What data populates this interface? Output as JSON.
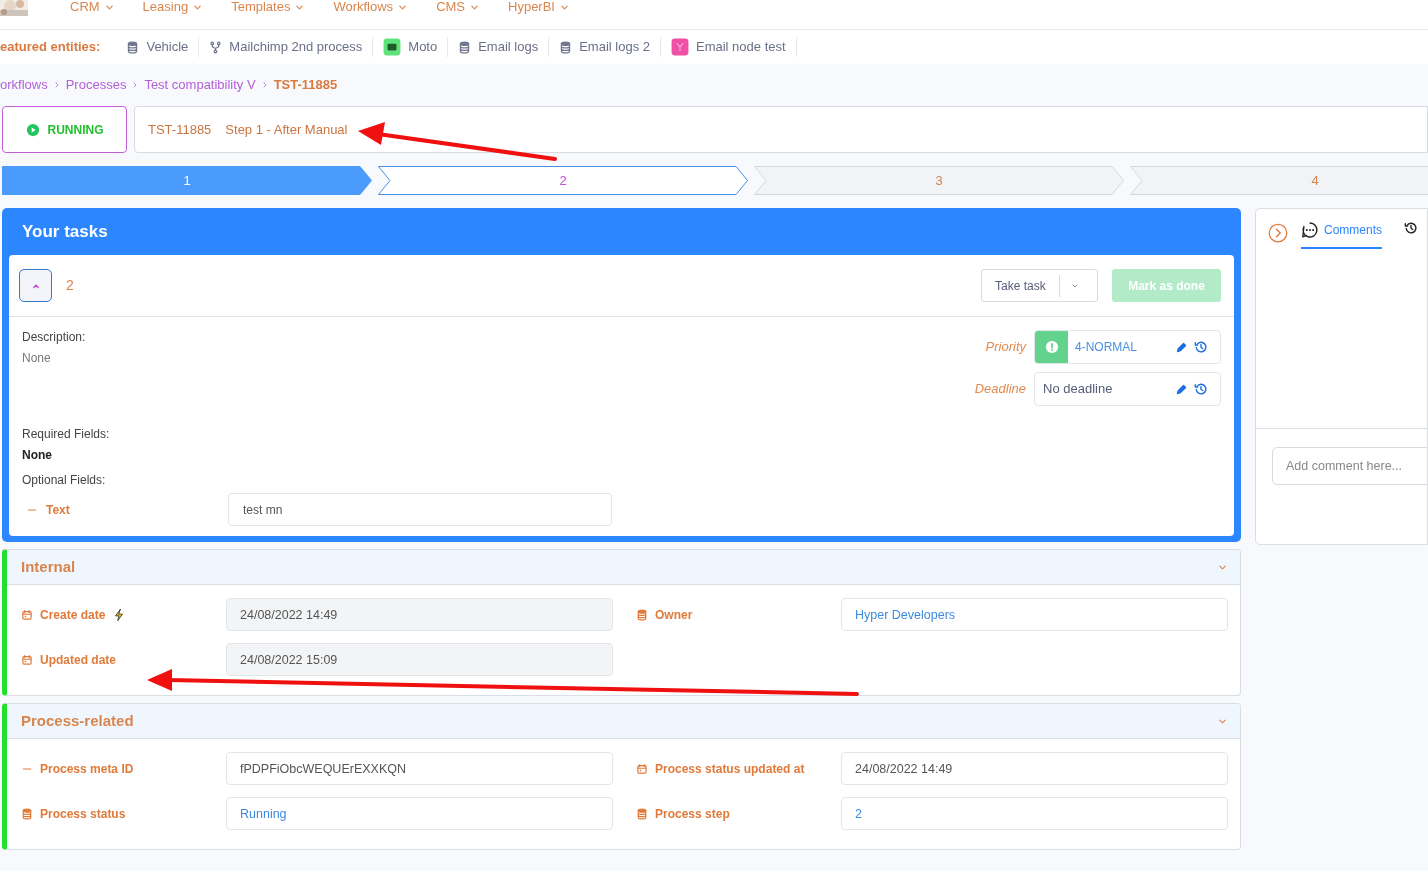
{
  "top_nav": {
    "items": [
      "CRM",
      "Leasing",
      "Templates",
      "Workflows",
      "CMS",
      "HyperBI"
    ]
  },
  "featured": {
    "label": "eatured entities:",
    "items": [
      {
        "kind": "database",
        "label": "Vehicle"
      },
      {
        "kind": "branch",
        "label": "Mailchimp 2nd process"
      },
      {
        "kind": "green-badge",
        "label": "Moto"
      },
      {
        "kind": "database",
        "label": "Email logs"
      },
      {
        "kind": "database",
        "label": "Email logs 2"
      },
      {
        "kind": "pink-badge",
        "label": "Email node test"
      }
    ]
  },
  "breadcrumb": [
    {
      "label": "orkflows",
      "current": false
    },
    {
      "label": "Processes",
      "current": false
    },
    {
      "label": "Test compatibility V",
      "current": false
    },
    {
      "label": "TST-11885",
      "current": true
    }
  ],
  "status": {
    "label": "RUNNING"
  },
  "process_title": {
    "id": "TST-11885",
    "step": "Step 1 - After Manual"
  },
  "steps": [
    {
      "label": "1",
      "kind": "done"
    },
    {
      "label": "2",
      "kind": "current"
    },
    {
      "label": "3",
      "kind": "pending"
    },
    {
      "label": "4",
      "kind": "pending"
    }
  ],
  "tasks": {
    "title": "Your tasks",
    "task": {
      "expanded": true,
      "name": "2",
      "take_button": "Take task",
      "done_button": {
        "label": "Mark as done",
        "disabled": true
      },
      "description_label": "Description:",
      "description": "None",
      "required_label": "Required Fields:",
      "required": "None",
      "optional_label": "Optional Fields:",
      "optional_fields": [
        {
          "label": "Text",
          "value": "test mn"
        }
      ],
      "priority": {
        "label": "Priority",
        "value": "4-NORMAL"
      },
      "deadline": {
        "label": "Deadline",
        "value": "No deadline"
      }
    }
  },
  "sections": [
    {
      "title": "Internal",
      "expanded": true,
      "fields": [
        {
          "kind": "calendar",
          "label": "Create date",
          "flash": true,
          "value": "24/08/2022 14:49",
          "readonly": true,
          "link": false
        },
        {
          "kind": "database",
          "label": "Owner",
          "value": "Hyper Developers",
          "readonly": false,
          "link": true
        },
        {
          "kind": "calendar",
          "label": "Updated date",
          "value": "24/08/2022 15:09",
          "readonly": true,
          "link": false
        }
      ]
    },
    {
      "title": "Process-related",
      "expanded": true,
      "fields": [
        {
          "kind": "dash",
          "label": "Process meta ID",
          "value": "fPDPFiObcWEQUErEXXKQN",
          "readonly": false,
          "link": false
        },
        {
          "kind": "calendar",
          "label": "Process status updated at",
          "value": "24/08/2022 14:49",
          "readonly": false,
          "link": false
        },
        {
          "kind": "database",
          "label": "Process status",
          "value": "Running",
          "readonly": false,
          "link": true
        },
        {
          "kind": "database",
          "label": "Process step",
          "value": "2",
          "readonly": false,
          "link": true
        }
      ]
    }
  ],
  "side_panel": {
    "tabs": [
      {
        "kind": "comments",
        "label": "Comments",
        "selected": true
      },
      {
        "kind": "history",
        "selected": false
      }
    ],
    "comment_placeholder": "Add comment here..."
  }
}
